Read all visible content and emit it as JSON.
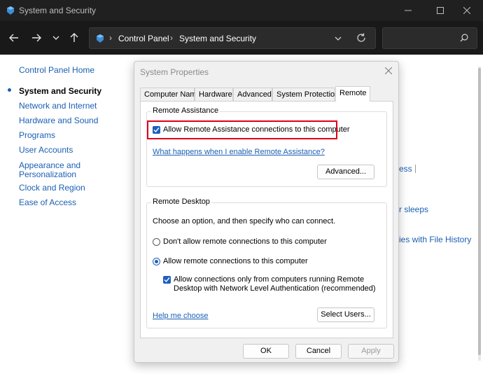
{
  "window": {
    "title": "System and Security"
  },
  "address_bar": {
    "crumbs": [
      "Control Panel",
      "System and Security"
    ]
  },
  "search": {
    "placeholder": ""
  },
  "left_nav": {
    "home": "Control Panel Home",
    "items": [
      {
        "label": "System and Security",
        "active": true
      },
      {
        "label": "Network and Internet"
      },
      {
        "label": "Hardware and Sound"
      },
      {
        "label": "Programs"
      },
      {
        "label": "User Accounts"
      },
      {
        "label": "Appearance and"
      },
      {
        "label": "Personalization"
      },
      {
        "label": "Clock and Region"
      },
      {
        "label": "Ease of Access"
      }
    ]
  },
  "background_links": {
    "a": "ess",
    "b": "r sleeps",
    "c": "ies with File History"
  },
  "dialog": {
    "title": "System Properties",
    "tabs": [
      "Computer Name",
      "Hardware",
      "Advanced",
      "System Protection",
      "Remote"
    ],
    "active_tab": "Remote",
    "remote_assistance": {
      "group_label": "Remote Assistance",
      "allow_label": "Allow Remote Assistance connections to this computer",
      "allow_checked": true,
      "help_link": "What happens when I enable Remote Assistance?",
      "advanced_button": "Advanced..."
    },
    "remote_desktop": {
      "group_label": "Remote Desktop",
      "instruction": "Choose an option, and then specify who can connect.",
      "option_deny": "Don't allow remote connections to this computer",
      "option_allow": "Allow remote connections to this computer",
      "selected": "allow",
      "nla_label_line1": "Allow connections only from computers running Remote",
      "nla_label_line2": "Desktop with Network Level Authentication (recommended)",
      "nla_checked": true,
      "help_link": "Help me choose",
      "select_users_button": "Select Users..."
    },
    "buttons": {
      "ok": "OK",
      "cancel": "Cancel",
      "apply": "Apply"
    }
  },
  "colors": {
    "titlebar": "#202020",
    "link": "#1a5fb4",
    "highlight": "#e0001b",
    "checkbox": "#1f5fbf"
  }
}
